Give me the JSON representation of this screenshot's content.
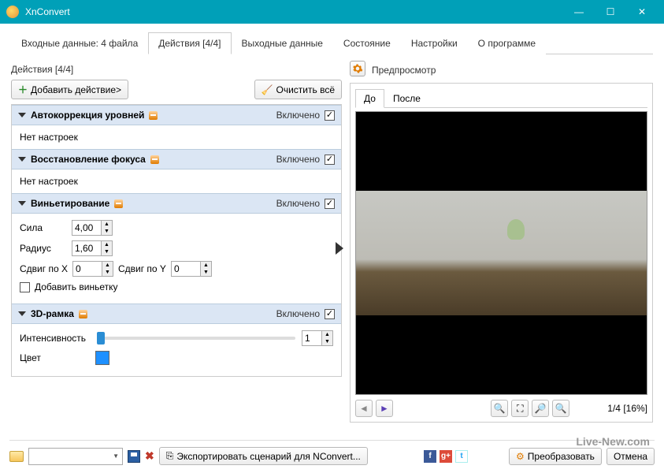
{
  "window": {
    "title": "XnConvert"
  },
  "tabs": [
    {
      "label": "Входные данные: 4 файла"
    },
    {
      "label": "Действия [4/4]"
    },
    {
      "label": "Выходные данные"
    },
    {
      "label": "Состояние"
    },
    {
      "label": "Настройки"
    },
    {
      "label": "О программе"
    }
  ],
  "sectionLabel": "Действия [4/4]",
  "toolbar": {
    "add": "Добавить действие>",
    "clear": "Очистить всё"
  },
  "enabledLabel": "Включено",
  "actions": [
    {
      "name": "Автокоррекция уровней",
      "body": "Нет настроек"
    },
    {
      "name": "Восстановление фокуса",
      "body": "Нет настроек"
    },
    {
      "name": "Виньетирование",
      "fields": {
        "strengthLabel": "Сила",
        "strength": "4,00",
        "radiusLabel": "Радиус",
        "radius": "1,60",
        "shiftXLabel": "Сдвиг по X",
        "shiftX": "0",
        "shiftYLabel": "Сдвиг по Y",
        "shiftY": "0",
        "addVignette": "Добавить виньетку"
      }
    },
    {
      "name": "3D-рамка",
      "fields": {
        "intensityLabel": "Интенсивность",
        "intensity": "1",
        "colorLabel": "Цвет"
      }
    }
  ],
  "preview": {
    "label": "Предпросмотр",
    "beforeTab": "До",
    "afterTab": "После",
    "counter": "1/4 [16%]"
  },
  "bottom": {
    "export": "Экспортировать сценарий для NConvert...",
    "convert": "Преобразовать",
    "cancel": "Отмена"
  },
  "watermark": "Live-New.com"
}
